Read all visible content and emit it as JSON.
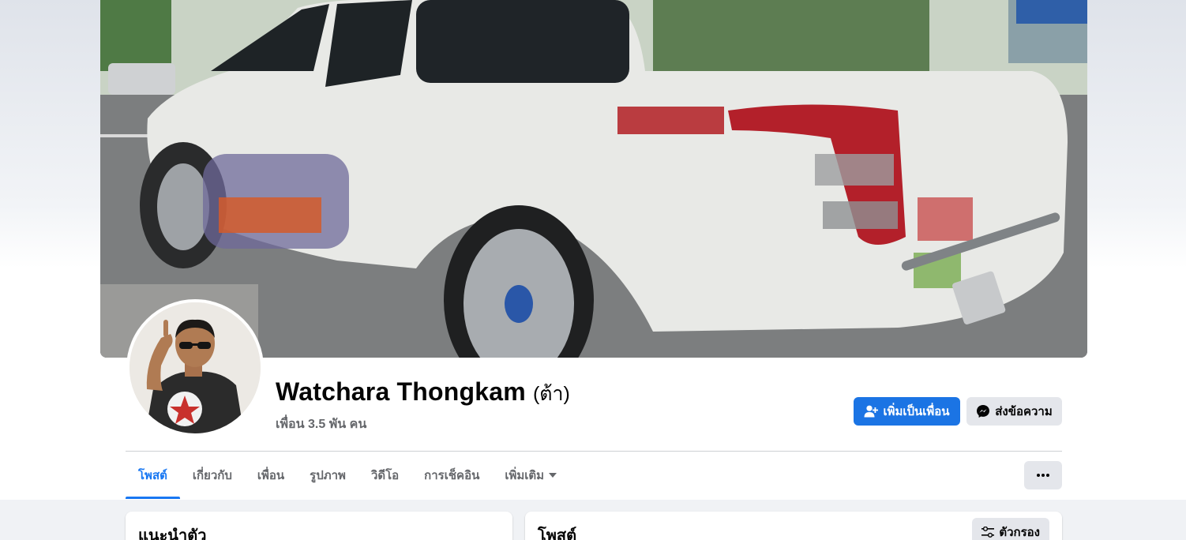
{
  "profile": {
    "name": "Watchara Thongkam",
    "nickname": "(ต้า)",
    "friends_count": "เพื่อน 3.5 พัน คน"
  },
  "actions": {
    "add_friend_label": "เพิ่มเป็นเพื่อน",
    "message_label": "ส่งข้อความ",
    "add_friend_icon": "person-add-icon",
    "message_icon": "messenger-icon",
    "more_icon": "more-horizontal-icon"
  },
  "tabs": [
    {
      "label": "โพสต์",
      "active": true
    },
    {
      "label": "เกี่ยวกับ",
      "active": false
    },
    {
      "label": "เพื่อน",
      "active": false
    },
    {
      "label": "รูปภาพ",
      "active": false
    },
    {
      "label": "วิดีโอ",
      "active": false
    },
    {
      "label": "การเช็คอิน",
      "active": false
    },
    {
      "label": "เพิ่มเติม",
      "active": false
    }
  ],
  "intro_card": {
    "title": "แนะนำตัว"
  },
  "posts_card": {
    "title": "โพสต์",
    "filter_label": "ตัวกรอง",
    "filter_icon": "filter-sliders-icon"
  },
  "colors": {
    "accent": "#1877f2",
    "primary_button": "#1b74e4",
    "secondary_button": "#e4e6eb",
    "page_background": "#f0f2f5"
  }
}
